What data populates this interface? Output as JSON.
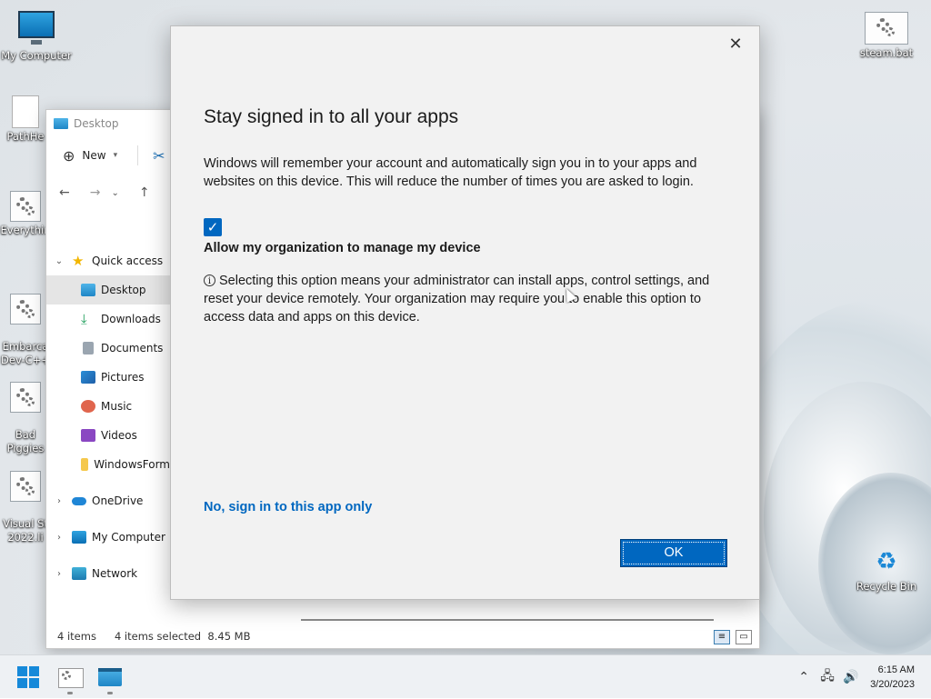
{
  "desktop": {
    "icons": [
      {
        "label": "My Computer"
      },
      {
        "label": "PathHe"
      },
      {
        "label": "Everythin"
      },
      {
        "label": "Embarca\nDev-C++"
      },
      {
        "label": "Bad\nPiggies"
      },
      {
        "label": "Visual St\n2022.li"
      },
      {
        "label": "steam.bat"
      },
      {
        "label": "Recycle Bin"
      }
    ]
  },
  "explorer": {
    "title": "Desktop",
    "new_label": "New",
    "quick_access": "Quick access",
    "nav_items": [
      "Desktop",
      "Downloads",
      "Documents",
      "Pictures",
      "Music",
      "Videos",
      "WindowsForm"
    ],
    "onedrive": "OneDrive",
    "my_computer": "My Computer",
    "network": "Network",
    "status_items": "4 items",
    "status_selected": "4 items selected  8.45 MB"
  },
  "dialog": {
    "title": "Stay signed in to all your apps",
    "description": "Windows will remember your account and automatically sign you in to your apps and websites on this device. This will reduce the number of times you are asked to login.",
    "checkbox_label": "Allow my organization to manage my device",
    "info_text": "Selecting this option means your administrator can install apps, control settings, and reset your device remotely. Your organization may require you to enable this option to access data and apps on this device.",
    "link_label": "No, sign in to this app only",
    "ok_label": "OK",
    "checkbox_checked": true
  },
  "taskbar": {
    "time": "6:15 AM",
    "date": "3/20/2023"
  },
  "colors": {
    "accent": "#0067c0"
  }
}
